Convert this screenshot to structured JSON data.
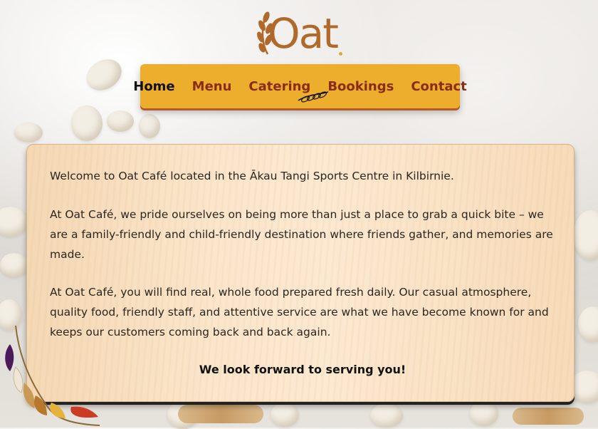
{
  "brand": {
    "logo_text": "Oat"
  },
  "nav": {
    "items": [
      {
        "label": "Home",
        "active": true
      },
      {
        "label": "Menu",
        "active": false
      },
      {
        "label": "Catering",
        "active": false
      },
      {
        "label": "Bookings",
        "active": false
      },
      {
        "label": "Contact",
        "active": false
      }
    ]
  },
  "content": {
    "paragraph_1": "Welcome to Oat Café located in the Ākau Tangi Sports Centre in Kilbirnie.",
    "paragraph_2": "At Oat Café, we pride ourselves on being more than just a place to grab a quick bite – we are a family-friendly and child-friendly destination where friends gather, and memories are made.",
    "paragraph_3": "At Oat Café, you will find real, whole food prepared fresh daily. Our casual atmosphere, quality food, friendly staff, and attentive service are what we have become known for and keeps our customers coming back and back again.",
    "closing": "We look forward to serving you!"
  },
  "colors": {
    "nav_background": "#edae2d",
    "nav_link": "#8a2d16",
    "nav_active": "#111111",
    "logo": "#b0692a"
  },
  "icons": [
    "oat-sprig-icon",
    "nav-active-sprig-icon",
    "feather-decoration-icon"
  ]
}
